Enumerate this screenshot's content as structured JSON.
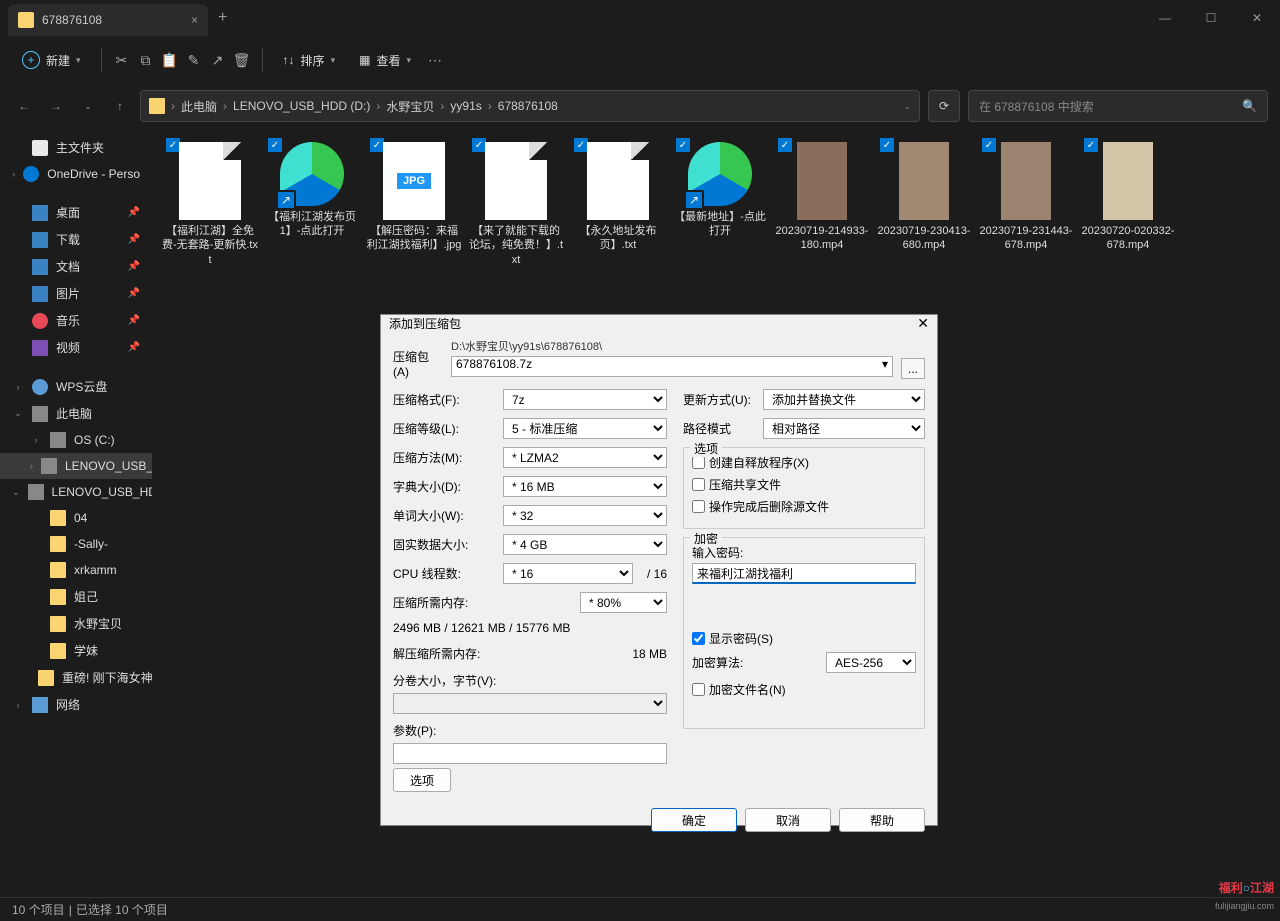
{
  "tab_title": "678876108",
  "toolbar": {
    "new": "新建",
    "sort": "排序",
    "view": "查看"
  },
  "breadcrumb": [
    "此电脑",
    "LENOVO_USB_HDD (D:)",
    "水野宝贝",
    "yy91s",
    "678876108"
  ],
  "search_placeholder": "在 678876108 中搜索",
  "sidebar": {
    "home": "主文件夹",
    "onedrive": "OneDrive - Perso",
    "desktop": "桌面",
    "downloads": "下载",
    "documents": "文档",
    "pictures": "图片",
    "music": "音乐",
    "videos": "视频",
    "wps": "WPS云盘",
    "pc": "此电脑",
    "osc": "OS (C:)",
    "usbhdd": "LENOVO_USB_H",
    "usbhdd2": "LENOVO_USB_HD",
    "f04": "04",
    "sally": "-Sally-",
    "xrk": "xrkamm",
    "juji": "姐己",
    "mizuno": "水野宝贝",
    "xuemei": "学妹",
    "zhongbang": "重磅! 刚下海女神",
    "network": "网络"
  },
  "files": [
    {
      "name": "【福利江湖】全免费-无套路-更新快.txt",
      "type": "txt"
    },
    {
      "name": "【福利江湖发布页1】-点此打开",
      "type": "edge"
    },
    {
      "name": "【解压密码：来福利江湖找福利】.jpg",
      "type": "jpg"
    },
    {
      "name": "【来了就能下载的论坛，纯免费！】.txt",
      "type": "txt"
    },
    {
      "name": "【永久地址发布页】.txt",
      "type": "txt"
    },
    {
      "name": "【最新地址】-点此打开",
      "type": "edge"
    },
    {
      "name": "20230719-214933-180.mp4",
      "type": "vid"
    },
    {
      "name": "20230719-230413-680.mp4",
      "type": "vid2"
    },
    {
      "name": "20230719-231443-678.mp4",
      "type": "vid3"
    },
    {
      "name": "20230720-020332-678.mp4",
      "type": "vid4"
    }
  ],
  "status": {
    "count": "10 个项目",
    "sel": "已选择 10 个项目"
  },
  "dialog": {
    "title": "添加到压缩包",
    "archive_lbl": "压缩包(A)",
    "archive_path": "D:\\水野宝贝\\yy91s\\678876108\\",
    "archive_name": "678876108.7z",
    "browse": "...",
    "format_lbl": "压缩格式(F):",
    "format": "7z",
    "level_lbl": "压缩等级(L):",
    "level": "5 - 标准压缩",
    "method_lbl": "压缩方法(M):",
    "method": "* LZMA2",
    "dict_lbl": "字典大小(D):",
    "dict": "* 16 MB",
    "word_lbl": "单词大小(W):",
    "word": "* 32",
    "solid_lbl": "固实数据大小:",
    "solid": "* 4 GB",
    "threads_lbl": "CPU 线程数:",
    "threads": "* 16",
    "threads_max": "/ 16",
    "memc_lbl": "压缩所需内存:",
    "memc_sel": "* 80%",
    "memc_val": "2496 MB / 12621 MB / 15776 MB",
    "memd_lbl": "解压缩所需内存:",
    "memd_val": "18 MB",
    "split_lbl": "分卷大小，字节(V):",
    "params_lbl": "参数(P):",
    "options_btn": "选项",
    "update_lbl": "更新方式(U):",
    "update": "添加并替换文件",
    "path_lbl": "路径模式",
    "path": "相对路径",
    "opts_legend": "选项",
    "opt_sfx": "创建自释放程序(X)",
    "opt_shared": "压缩共享文件",
    "opt_del": "操作完成后删除源文件",
    "enc_legend": "加密",
    "pwd_lbl": "输入密码:",
    "pwd_val": "来福利江湖找福利",
    "show_pwd": "显示密码(S)",
    "encm_lbl": "加密算法:",
    "encm": "AES-256",
    "enc_names": "加密文件名(N)",
    "ok": "确定",
    "cancel": "取消",
    "help": "帮助"
  },
  "watermark": {
    "a": "福利",
    "b": "江湖",
    "sub": "fulijiangjiu.com"
  }
}
